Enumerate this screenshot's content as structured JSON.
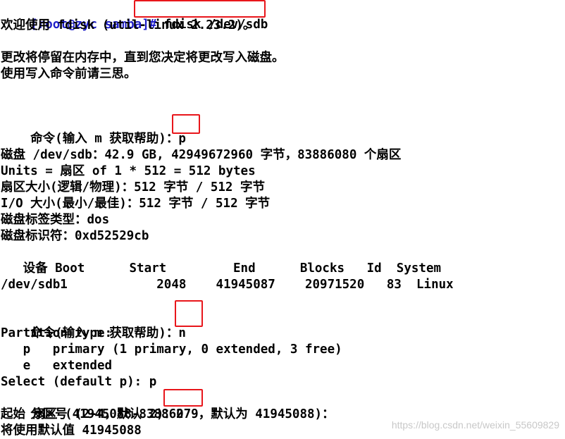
{
  "terminal": {
    "prompt": "[root@zyc samba]#",
    "command": " fdisk /dev/sdb",
    "lines": {
      "welcome": "欢迎使用 fdisk (util-linux 2.23.2)。",
      "notice1": "更改将停留在内存中，直到您决定将更改写入磁盘。",
      "notice2": "使用写入命令前请三思。",
      "cmd_prompt_1": "命令(输入 m 获取帮助)：",
      "cmd_input_1": "p",
      "disk_info": "磁盘 /dev/sdb：42.9 GB, 42949672960 字节，83886080 个扇区",
      "units": "Units = 扇区 of 1 * 512 = 512 bytes",
      "sector_size": "扇区大小(逻辑/物理)：512 字节 / 512 字节",
      "io_size": "I/O 大小(最小/最佳)：512 字节 / 512 字节",
      "label_type": "磁盘标签类型：dos",
      "identifier": "磁盘标识符：0xd52529cb",
      "table_header": "   设备 Boot      Start         End      Blocks   Id  System",
      "table_row": "/dev/sdb1            2048    41945087    20971520   83  Linux",
      "cmd_prompt_2": "命令(输入 m 获取帮助)：",
      "cmd_input_2": "n",
      "partition_type": "Partition type:",
      "opt_primary": "   p   primary (1 primary, 0 extended, 3 free)",
      "opt_extended": "   e   extended",
      "select": "Select (default p): p",
      "partno_prompt": "分区号 (2-4，默认 2)：",
      "partno_input": "2",
      "start_sector": "起始 扇区 (41945088-83886079，默认为 41945088)：",
      "default_value": "将使用默认值 41945088"
    }
  },
  "watermark": "https://blog.csdn.net/weixin_55609829",
  "colors": {
    "highlight_box": "#e8161b",
    "prompt": "#1e1ec8",
    "text": "#000000"
  }
}
